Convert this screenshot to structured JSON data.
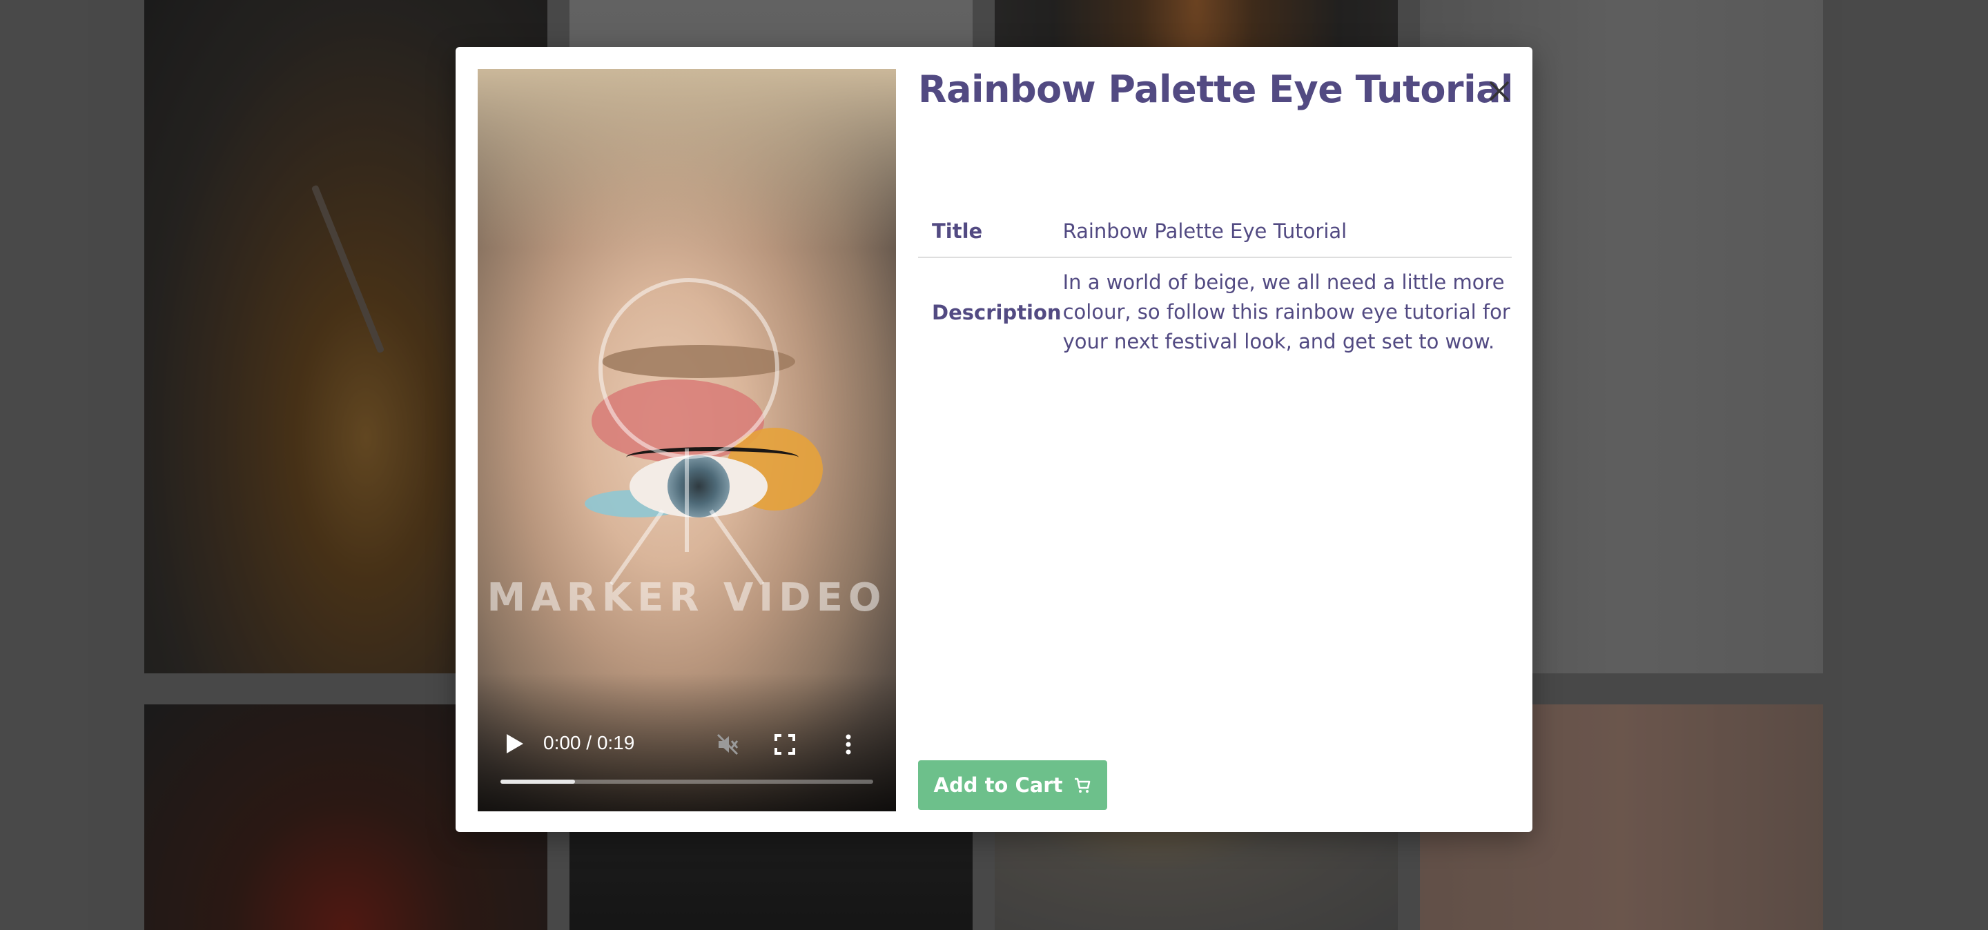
{
  "modal": {
    "title": "Rainbow Palette Eye Tutorial",
    "video": {
      "watermark": "MARKER VIDEO",
      "time_display": "0:00 / 0:19",
      "progress_fraction": 0.2
    },
    "details": {
      "title_label": "Title",
      "title_value": "Rainbow Palette Eye Tutorial",
      "description_label": "Description",
      "description_value": "In a world of beige, we all need a little more colour, so follow this rainbow eye tutorial for your next festival look, and get set to wow."
    },
    "add_to_cart_label": "Add to Cart"
  },
  "colors": {
    "title": "#524a82",
    "cart_button": "#6dc08b",
    "backdrop": "#000000"
  },
  "icons": [
    "close-icon",
    "play-icon",
    "mute-icon",
    "fullscreen-icon",
    "more-options-icon",
    "cart-icon"
  ]
}
